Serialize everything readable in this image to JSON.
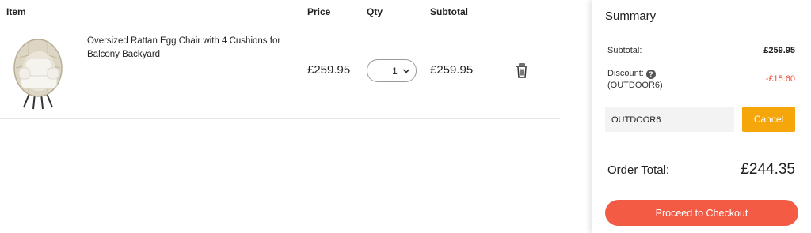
{
  "table": {
    "headers": {
      "item": "Item",
      "price": "Price",
      "qty": "Qty",
      "subtotal": "Subtotal"
    }
  },
  "cart_item": {
    "name": "Oversized Rattan Egg Chair with 4 Cushions for Balcony Backyard",
    "price": "£259.95",
    "qty": "1",
    "subtotal": "£259.95",
    "image_icon": "egg-chair-image",
    "delete_icon": "trash-icon"
  },
  "summary": {
    "title": "Summary",
    "subtotal_label": "Subtotal:",
    "subtotal_value": "£259.95",
    "discount_label": "Discount:",
    "discount_code": "(OUTDOOR6)",
    "discount_value": "-£15.60",
    "coupon_value": "OUTDOOR6",
    "cancel_label": "Cancel",
    "order_total_label": "Order Total:",
    "order_total_value": "£244.35",
    "checkout_label": "Proceed to Checkout"
  },
  "colors": {
    "accent_orange": "#f5a60a",
    "checkout_red": "#f45b45",
    "discount_red": "#e8503a"
  }
}
